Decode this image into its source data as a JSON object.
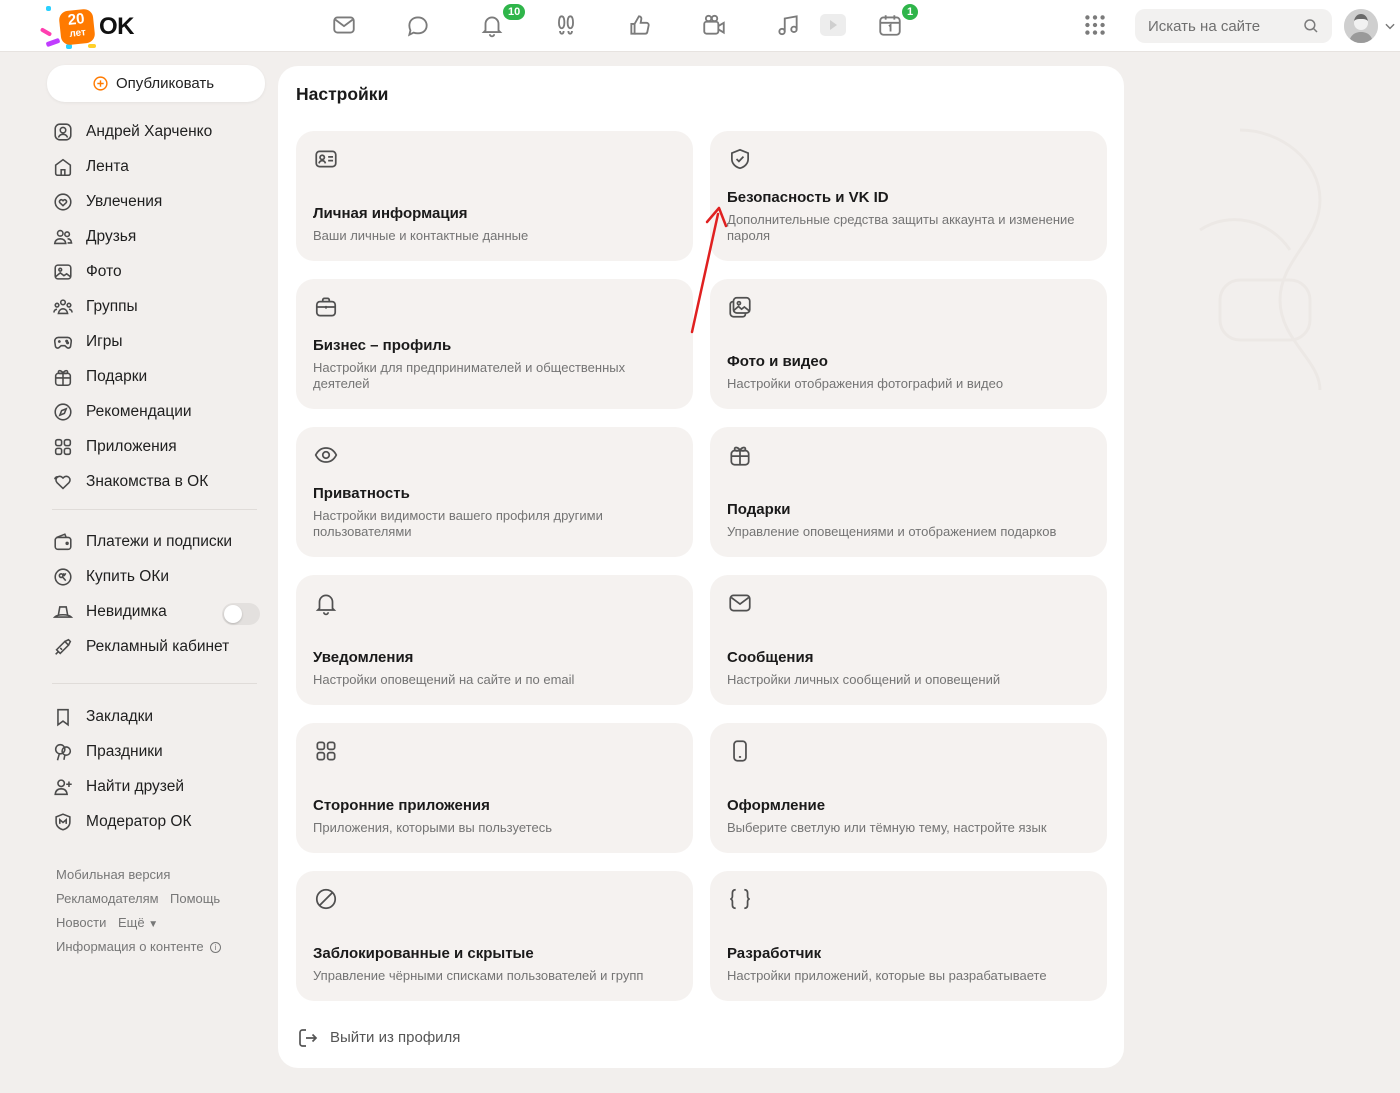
{
  "header": {
    "logo_badge_top": "20",
    "logo_badge_bottom": "лет",
    "logo_text": "OK",
    "notifications_count": "10",
    "calendar_count": "1",
    "nav_icons": [
      "messages-icon",
      "discussions-icon",
      "notifications-icon",
      "guests-icon",
      "likes-icon",
      "video-icon",
      "music-icon",
      "video-pill-icon",
      "calendar-icon"
    ],
    "search_placeholder": "Искать на сайте"
  },
  "sidebar": {
    "publish_label": "Опубликовать",
    "items": [
      {
        "label": "Андрей Харченко",
        "icon": "profile-icon"
      },
      {
        "label": "Лента",
        "icon": "home-icon"
      },
      {
        "label": "Увлечения",
        "icon": "hobby-icon"
      },
      {
        "label": "Друзья",
        "icon": "friends-icon"
      },
      {
        "label": "Фото",
        "icon": "photo-icon"
      },
      {
        "label": "Группы",
        "icon": "groups-icon"
      },
      {
        "label": "Игры",
        "icon": "games-icon"
      },
      {
        "label": "Подарки",
        "icon": "gift-icon"
      },
      {
        "label": "Рекомендации",
        "icon": "compass-icon"
      },
      {
        "label": "Приложения",
        "icon": "apps-icon"
      },
      {
        "label": "Знакомства в ОК",
        "icon": "dating-icon"
      }
    ],
    "items2": [
      {
        "label": "Платежи и подписки",
        "icon": "wallet-icon"
      },
      {
        "label": "Купить ОКи",
        "icon": "coin-icon"
      },
      {
        "label": "Невидимка",
        "icon": "invisible-icon"
      },
      {
        "label": "Рекламный кабинет",
        "icon": "megaphone-icon"
      }
    ],
    "items3": [
      {
        "label": "Закладки",
        "icon": "bookmark-icon"
      },
      {
        "label": "Праздники",
        "icon": "balloons-icon"
      },
      {
        "label": "Найти друзей",
        "icon": "add-friend-icon"
      },
      {
        "label": "Модератор ОК",
        "icon": "moderator-icon"
      }
    ],
    "footer": {
      "mobile": "Мобильная версия",
      "advertisers": "Рекламодателям",
      "help": "Помощь",
      "news": "Новости",
      "more": "Ещё",
      "content_info": "Информация о контенте"
    }
  },
  "main": {
    "title": "Настройки",
    "cards": [
      {
        "title": "Личная информация",
        "desc": "Ваши личные и контактные данные",
        "icon": "id-card-icon"
      },
      {
        "title": "Безопасность и VK ID",
        "desc": "Дополнительные средства защиты аккаунта и изменение пароля",
        "icon": "shield-icon"
      },
      {
        "title": "Бизнес – профиль",
        "desc": "Настройки для предпринимателей и общественных деятелей",
        "icon": "briefcase-icon"
      },
      {
        "title": "Фото и видео",
        "desc": "Настройки отображения фотографий и видео",
        "icon": "gallery-icon"
      },
      {
        "title": "Приватность",
        "desc": "Настройки видимости вашего профиля другими пользователями",
        "icon": "eye-icon"
      },
      {
        "title": "Подарки",
        "desc": "Управление оповещениями и отображением подарков",
        "icon": "gift-icon"
      },
      {
        "title": "Уведомления",
        "desc": "Настройки оповещений на сайте и по email",
        "icon": "bell-icon"
      },
      {
        "title": "Сообщения",
        "desc": "Настройки личных сообщений и оповещений",
        "icon": "envelope-icon"
      },
      {
        "title": "Сторонние приложения",
        "desc": "Приложения, которыми вы пользуетесь",
        "icon": "apps-grid-icon"
      },
      {
        "title": "Оформление",
        "desc": "Выберите светлую или тёмную тему, настройте язык",
        "icon": "phone-icon"
      },
      {
        "title": "Заблокированные и скрытые",
        "desc": "Управление чёрными списками пользователей и групп",
        "icon": "blocked-icon"
      },
      {
        "title": "Разработчик",
        "desc": "Настройки приложений, которые вы разрабатываете",
        "icon": "braces-icon"
      }
    ],
    "logout_label": "Выйти из профиля"
  },
  "colors": {
    "accent": "#ff7a00",
    "badge_green": "#2fb54a",
    "annotation_arrow": "#e02020",
    "card_bg": "#f5f2f0",
    "page_bg": "#f2efed"
  }
}
